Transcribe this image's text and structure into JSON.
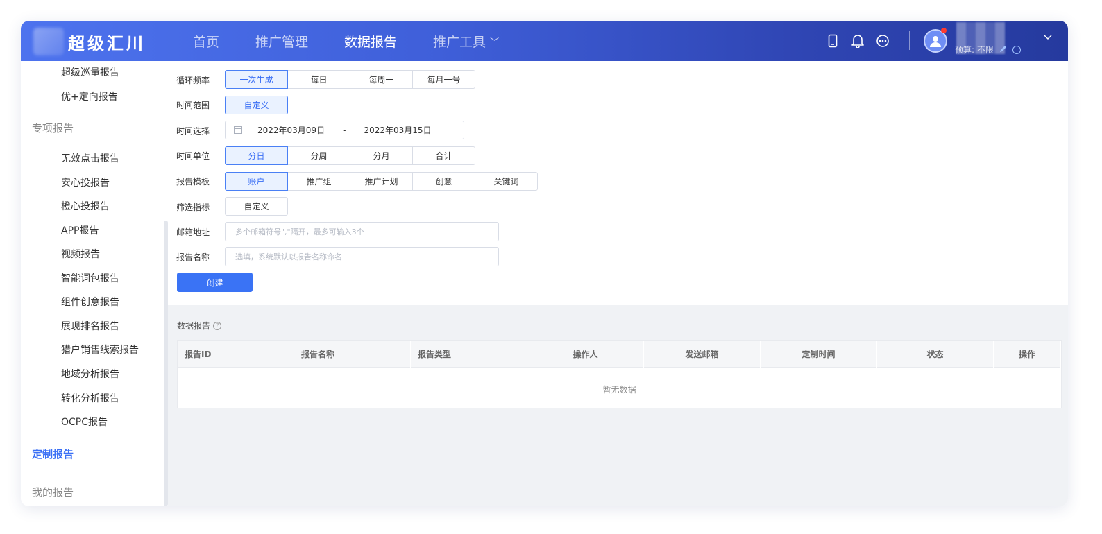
{
  "header": {
    "logo_text": "超级汇川",
    "nav": [
      {
        "label": "首页"
      },
      {
        "label": "推广管理"
      },
      {
        "label": "数据报告"
      },
      {
        "label": "推广工具"
      }
    ],
    "nav_chevron": "﹀",
    "icons": [
      "phone-icon",
      "bell-icon",
      "more-icon"
    ],
    "budget_text": "预算: 不限"
  },
  "sidebar": {
    "top_items": [
      {
        "label": "超级巡量报告"
      },
      {
        "label": "优+定向报告"
      }
    ],
    "group_special": "专项报告",
    "special_items": [
      {
        "label": "无效点击报告"
      },
      {
        "label": "安心投报告"
      },
      {
        "label": "橙心投报告"
      },
      {
        "label": "APP报告"
      },
      {
        "label": "视频报告"
      },
      {
        "label": "智能词包报告"
      },
      {
        "label": "组件创意报告"
      },
      {
        "label": "展现排名报告"
      },
      {
        "label": "猎户销售线索报告"
      },
      {
        "label": "地域分析报告"
      },
      {
        "label": "转化分析报告"
      },
      {
        "label": "OCPC报告"
      }
    ],
    "active_item": "定制报告",
    "group_mine": "我的报告"
  },
  "form": {
    "labels": {
      "frequency": "循环频率",
      "time_range": "时间范围",
      "time_select": "时间选择",
      "time_unit": "时间单位",
      "template": "报告模板",
      "filter": "筛选指标",
      "email": "邮箱地址",
      "name": "报告名称"
    },
    "frequency_options": [
      "一次生成",
      "每日",
      "每周一",
      "每月一号"
    ],
    "frequency_selected": 0,
    "time_range_option": "自定义",
    "date_start": "2022年03月09日",
    "date_sep": "-",
    "date_end": "2022年03月15日",
    "time_unit_options": [
      "分日",
      "分周",
      "分月",
      "合计"
    ],
    "time_unit_selected": 0,
    "template_options": [
      "账户",
      "推广组",
      "推广计划",
      "创意",
      "关键词"
    ],
    "template_selected": 0,
    "filter_option": "自定义",
    "email_placeholder": "多个邮箱符号\",\"隔开，最多可输入3个",
    "name_placeholder": "选填，系统默认以报告名称命名",
    "create_label": "创建"
  },
  "list": {
    "title": "数据报告",
    "help": "?",
    "columns": [
      "报告ID",
      "报告名称",
      "报告类型",
      "操作人",
      "发送邮箱",
      "定制时间",
      "状态",
      "操作"
    ],
    "empty_text": "暂无数据"
  },
  "colors": {
    "accent": "#3a73f5",
    "header_start": "#4d73ee",
    "header_end": "#253a9e",
    "selected_bg": "#eaf2ff"
  }
}
